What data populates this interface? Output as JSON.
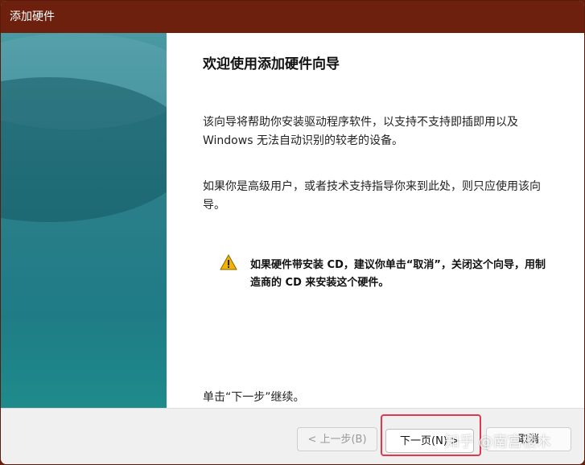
{
  "window": {
    "title": "添加硬件"
  },
  "wizard": {
    "heading": "欢迎使用添加硬件向导",
    "paragraph1": "该向导将帮助你安装驱动程序软件，以支持不支持即插即用以及 Windows 无法自动识别的较老的设备。",
    "paragraph2": "如果你是高级用户，或者技术支持指导你来到此处，则只应使用该向导。",
    "warning_text": "如果硬件带安装 CD，建议你单击“取消”，关闭这个向导，用制造商的 CD 来安装这个硬件。",
    "continue_text": "单击“下一步”继续。"
  },
  "buttons": {
    "back_label": "< 上一步(B)",
    "next_label": "下一页(N) >",
    "cancel_label": "取消"
  },
  "watermark": {
    "text": "知乎 @南宫樱木"
  },
  "icons": {
    "warning": "warning-triangle-icon"
  },
  "colors": {
    "titlebar": "#6c200d",
    "left_panel": "#2a7e8a",
    "highlight": "#e2384f",
    "warning": "#f2b400"
  }
}
